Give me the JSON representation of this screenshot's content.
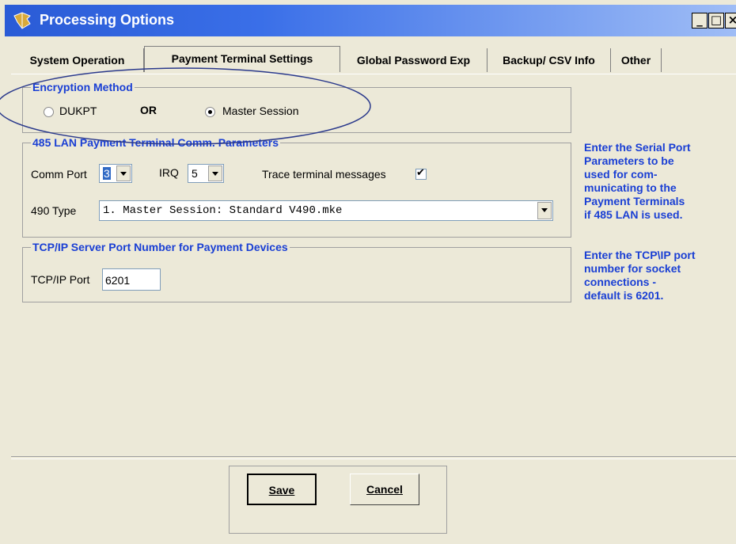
{
  "window": {
    "title": "Processing Options",
    "controls": {
      "minimize": "_",
      "maximize": "□",
      "close": "×"
    }
  },
  "tabs": [
    {
      "label": "System Operation",
      "active": false
    },
    {
      "label": "Payment Terminal Settings",
      "active": true
    },
    {
      "label": "Global Password Exp",
      "active": false
    },
    {
      "label": "Backup/ CSV Info",
      "active": false
    },
    {
      "label": "Other",
      "active": false
    }
  ],
  "encryption": {
    "legend": "Encryption Method",
    "option_dukpt": "DUKPT",
    "or_label": "OR",
    "option_master": "Master Session",
    "selected": "Master Session"
  },
  "lan": {
    "legend": "485 LAN Payment Terminal Comm. Parameters",
    "comm_port_label": "Comm Port",
    "comm_port_value": "3",
    "irq_label": "IRQ",
    "irq_value": "5",
    "trace_label": "Trace terminal messages",
    "trace_checked": true,
    "type_label": "490 Type",
    "type_value": "1. Master Session: Standard V490.mke"
  },
  "tcp": {
    "legend": "TCP/IP Server Port Number for Payment Devices",
    "port_label": "TCP/IP Port",
    "port_value": "6201"
  },
  "help": {
    "serial_lines": [
      "Enter the Serial Port",
      "Parameters to be",
      "used for com-",
      "municating to the",
      "Payment Terminals",
      "if 485 LAN is used."
    ],
    "tcp_lines": [
      "Enter the TCP\\IP port",
      "number for socket",
      "connections -",
      "default is 6201."
    ]
  },
  "buttons": {
    "save": "Save",
    "cancel": "Cancel"
  },
  "colors": {
    "accent_text": "#1a3fd4",
    "titlebar": "#2a5bd6",
    "dialog_bg": "#ece9d8",
    "annotation": "#2b3a8c"
  }
}
